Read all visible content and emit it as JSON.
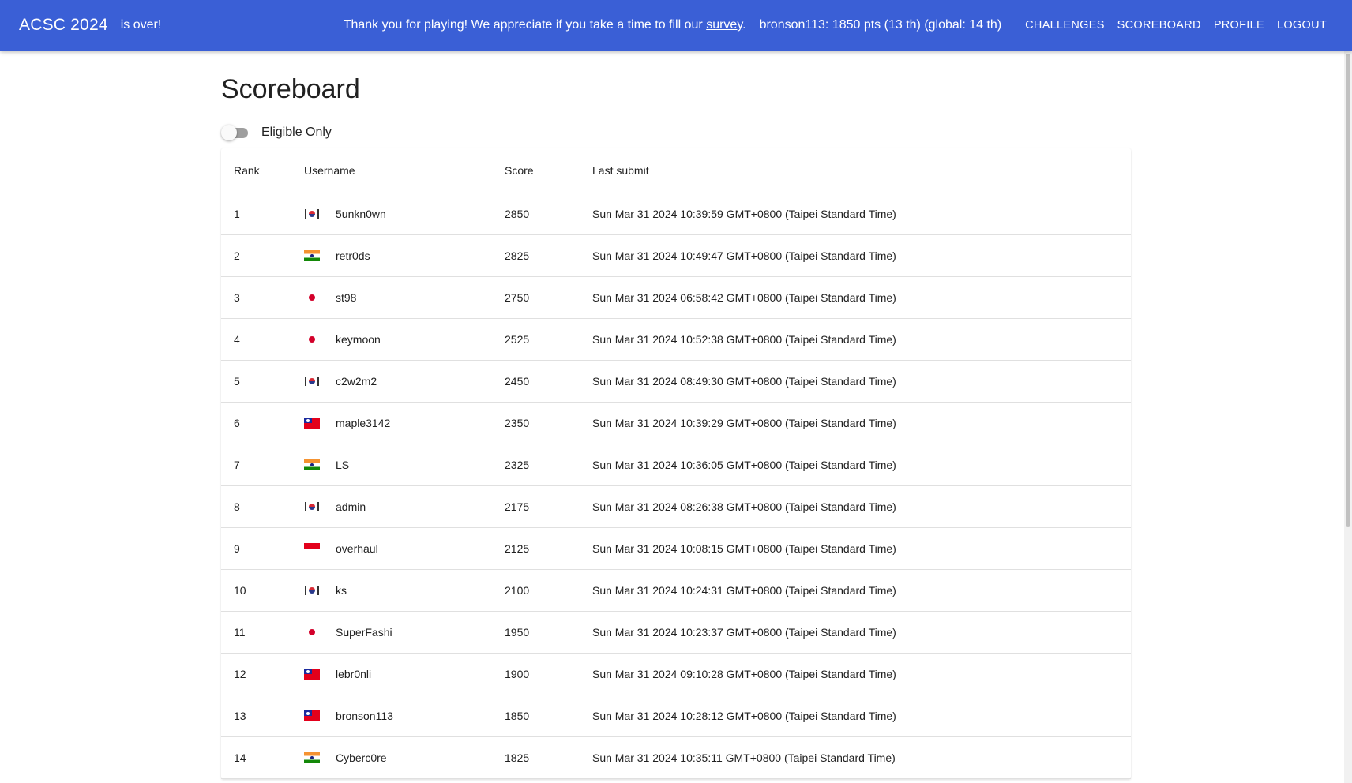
{
  "appbar": {
    "brand": "ACSC 2024",
    "status_suffix": "is over!",
    "message_before_link": "Thank you for playing! We appreciate if you take a time to fill our ",
    "survey_link": "survey",
    "message_after_link": ".",
    "user_status": "bronson113: 1850 pts (13 th) (global: 14 th)",
    "nav": [
      "CHALLENGES",
      "SCOREBOARD",
      "PROFILE",
      "LOGOUT"
    ]
  },
  "page": {
    "title": "Scoreboard",
    "toggle_label": "Eligible Only",
    "toggle_on": false
  },
  "table": {
    "headers": [
      "Rank",
      "Username",
      "Score",
      "Last submit"
    ],
    "rows": [
      {
        "rank": "1",
        "flag": "kr",
        "username": "5unkn0wn",
        "score": "2850",
        "last_submit": "Sun Mar 31 2024 10:39:59 GMT+0800 (Taipei Standard Time)"
      },
      {
        "rank": "2",
        "flag": "in",
        "username": "retr0ds",
        "score": "2825",
        "last_submit": "Sun Mar 31 2024 10:49:47 GMT+0800 (Taipei Standard Time)"
      },
      {
        "rank": "3",
        "flag": "jp",
        "username": "st98",
        "score": "2750",
        "last_submit": "Sun Mar 31 2024 06:58:42 GMT+0800 (Taipei Standard Time)"
      },
      {
        "rank": "4",
        "flag": "jp",
        "username": "keymoon",
        "score": "2525",
        "last_submit": "Sun Mar 31 2024 10:52:38 GMT+0800 (Taipei Standard Time)"
      },
      {
        "rank": "5",
        "flag": "kr",
        "username": "c2w2m2",
        "score": "2450",
        "last_submit": "Sun Mar 31 2024 08:49:30 GMT+0800 (Taipei Standard Time)"
      },
      {
        "rank": "6",
        "flag": "tw",
        "username": "maple3142",
        "score": "2350",
        "last_submit": "Sun Mar 31 2024 10:39:29 GMT+0800 (Taipei Standard Time)"
      },
      {
        "rank": "7",
        "flag": "in",
        "username": "LS",
        "score": "2325",
        "last_submit": "Sun Mar 31 2024 10:36:05 GMT+0800 (Taipei Standard Time)"
      },
      {
        "rank": "8",
        "flag": "kr",
        "username": "admin",
        "score": "2175",
        "last_submit": "Sun Mar 31 2024 08:26:38 GMT+0800 (Taipei Standard Time)"
      },
      {
        "rank": "9",
        "flag": "id",
        "username": "overhaul",
        "score": "2125",
        "last_submit": "Sun Mar 31 2024 10:08:15 GMT+0800 (Taipei Standard Time)"
      },
      {
        "rank": "10",
        "flag": "kr",
        "username": "ks",
        "score": "2100",
        "last_submit": "Sun Mar 31 2024 10:24:31 GMT+0800 (Taipei Standard Time)"
      },
      {
        "rank": "11",
        "flag": "jp",
        "username": "SuperFashi",
        "score": "1950",
        "last_submit": "Sun Mar 31 2024 10:23:37 GMT+0800 (Taipei Standard Time)"
      },
      {
        "rank": "12",
        "flag": "tw",
        "username": "lebr0nli",
        "score": "1900",
        "last_submit": "Sun Mar 31 2024 09:10:28 GMT+0800 (Taipei Standard Time)"
      },
      {
        "rank": "13",
        "flag": "tw",
        "username": "bronson113",
        "score": "1850",
        "last_submit": "Sun Mar 31 2024 10:28:12 GMT+0800 (Taipei Standard Time)"
      },
      {
        "rank": "14",
        "flag": "in",
        "username": "Cyberc0re",
        "score": "1825",
        "last_submit": "Sun Mar 31 2024 10:35:11 GMT+0800 (Taipei Standard Time)"
      }
    ]
  }
}
